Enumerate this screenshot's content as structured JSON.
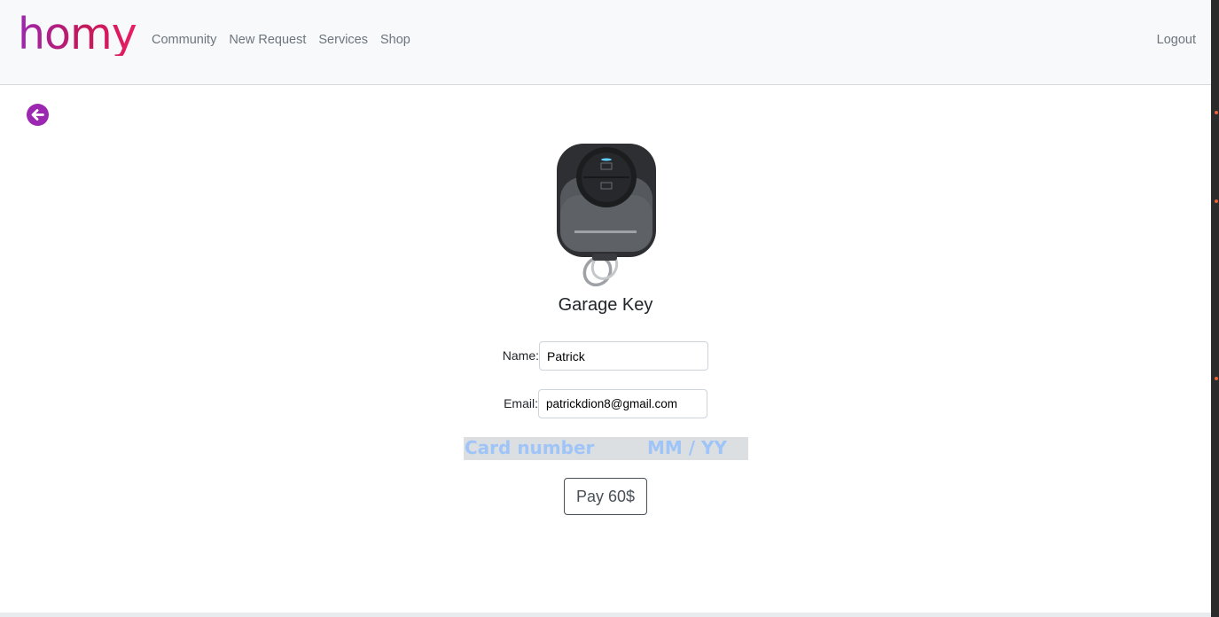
{
  "brand": "homy",
  "nav": {
    "links": [
      "Community",
      "New Request",
      "Services",
      "Shop"
    ],
    "logout": "Logout"
  },
  "back": {
    "icon": "arrow-left-circle-icon"
  },
  "product": {
    "image_icon": "garage-key-fob-image",
    "title": "Garage Key"
  },
  "form": {
    "name_label": "Name:",
    "name_value": "Patrick",
    "email_label": "Email:",
    "email_value": "patrickdion8@gmail.com",
    "card_placeholder": "Card number",
    "expiry_placeholder": "MM / YY",
    "pay_label": "Pay 60$"
  },
  "colors": {
    "accent": "#9c27b0",
    "brand_pink": "#e91e63",
    "card_placeholder": "#9fc4f7"
  }
}
